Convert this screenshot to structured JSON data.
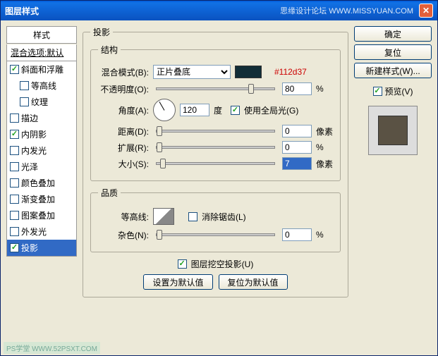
{
  "title": "图层样式",
  "watermark": "思缘设计论坛  WWW.MISSYUAN.COM",
  "sidebar": {
    "header": "样式",
    "blend": "混合选项:默认",
    "items": [
      {
        "label": "斜面和浮雕",
        "checked": true,
        "indent": false
      },
      {
        "label": "等高线",
        "checked": false,
        "indent": true
      },
      {
        "label": "纹理",
        "checked": false,
        "indent": true
      },
      {
        "label": "描边",
        "checked": false,
        "indent": false
      },
      {
        "label": "内阴影",
        "checked": true,
        "indent": false
      },
      {
        "label": "内发光",
        "checked": false,
        "indent": false
      },
      {
        "label": "光泽",
        "checked": false,
        "indent": false
      },
      {
        "label": "颜色叠加",
        "checked": false,
        "indent": false
      },
      {
        "label": "渐变叠加",
        "checked": false,
        "indent": false
      },
      {
        "label": "图案叠加",
        "checked": false,
        "indent": false
      },
      {
        "label": "外发光",
        "checked": false,
        "indent": false
      },
      {
        "label": "投影",
        "checked": true,
        "indent": false,
        "selected": true
      }
    ]
  },
  "panel": {
    "title": "投影",
    "structure": {
      "legend": "结构",
      "blend_mode_label": "混合模式(B):",
      "blend_mode_value": "正片叠底",
      "color": "#112d37",
      "hex_label": "#112d37",
      "opacity_label": "不透明度(O):",
      "opacity_value": "80",
      "opacity_unit": "%",
      "angle_label": "角度(A):",
      "angle_value": "120",
      "angle_unit": "度",
      "global_light": "使用全局光(G)",
      "global_light_checked": true,
      "distance_label": "距离(D):",
      "distance_value": "0",
      "distance_unit": "像素",
      "spread_label": "扩展(R):",
      "spread_value": "0",
      "spread_unit": "%",
      "size_label": "大小(S):",
      "size_value": "7",
      "size_unit": "像素"
    },
    "quality": {
      "legend": "品质",
      "contour_label": "等高线:",
      "antialias": "消除锯齿(L)",
      "antialias_checked": false,
      "noise_label": "杂色(N):",
      "noise_value": "0",
      "noise_unit": "%"
    },
    "knockout": "图层挖空投影(U)",
    "knockout_checked": true,
    "set_default": "设置为默认值",
    "reset_default": "复位为默认值"
  },
  "right": {
    "ok": "确定",
    "cancel": "复位",
    "new_style": "新建样式(W)...",
    "preview": "预览(V)",
    "preview_checked": true
  },
  "footer": "PS学堂  WWW.52PSXT.COM"
}
